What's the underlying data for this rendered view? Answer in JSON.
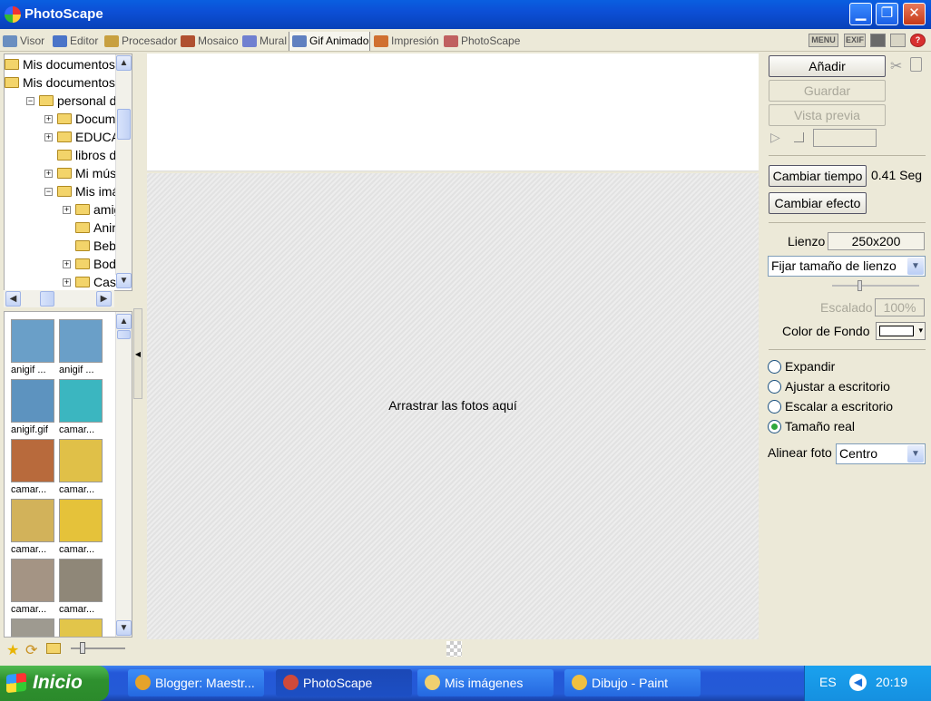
{
  "window": {
    "title": "PhotoScape",
    "minimize": "▁",
    "maximize": "❐",
    "close": "✕"
  },
  "tabs": [
    {
      "label": "Visor",
      "color": "#6b8fc0"
    },
    {
      "label": "Editor",
      "color": "#4a74c8"
    },
    {
      "label": "Procesador",
      "color": "#c8a040"
    },
    {
      "label": "Mosaico",
      "color": "#b05030"
    },
    {
      "label": "Mural",
      "color": "#7080d0"
    },
    {
      "label": "Gif Animado",
      "color": "#6080c0"
    },
    {
      "label": "Impresión",
      "color": "#d07030"
    },
    {
      "label": "PhotoScape",
      "color": "#c06060"
    }
  ],
  "active_tab": "Gif Animado",
  "toolbar_icons": {
    "menu": "MENU",
    "exif": "EXIF",
    "help": "?"
  },
  "tree": [
    {
      "label": "Mis documentos",
      "level": 0,
      "expander": ""
    },
    {
      "label": "Mis documentos",
      "level": 0,
      "expander": ""
    },
    {
      "label": "personal de n",
      "level": 1,
      "expander": "−"
    },
    {
      "label": "Documen",
      "level": 2,
      "expander": "+"
    },
    {
      "label": "EDUCACI",
      "level": 2,
      "expander": "+"
    },
    {
      "label": "libros digit",
      "level": 2,
      "expander": ""
    },
    {
      "label": "Mi música",
      "level": 2,
      "expander": "+"
    },
    {
      "label": "Mis imáge",
      "level": 2,
      "expander": "−"
    },
    {
      "label": "amigos",
      "level": 3,
      "expander": "+"
    },
    {
      "label": "Animal",
      "level": 3,
      "expander": ""
    },
    {
      "label": "Bebés",
      "level": 3,
      "expander": ""
    },
    {
      "label": "Bodas",
      "level": 3,
      "expander": "+"
    },
    {
      "label": "Casas",
      "level": 3,
      "expander": "+"
    }
  ],
  "thumbnails": [
    {
      "label": "anigif ...",
      "color": "#6a9fc8"
    },
    {
      "label": "anigif ...",
      "color": "#6a9fc8"
    },
    {
      "label": "anigif.gif",
      "color": "#5d93bf"
    },
    {
      "label": "camar...",
      "color": "#3bb6c0"
    },
    {
      "label": "camar...",
      "color": "#b86a3c"
    },
    {
      "label": "camar...",
      "color": "#e0c048"
    },
    {
      "label": "camar...",
      "color": "#d2b25a"
    },
    {
      "label": "camar...",
      "color": "#e5c23a"
    },
    {
      "label": "camar...",
      "color": "#a49484"
    },
    {
      "label": "camar...",
      "color": "#8f8778"
    },
    {
      "label": "",
      "color": "#9e9a90"
    },
    {
      "label": "",
      "color": "#e2c54a"
    }
  ],
  "stage": {
    "drop_hint": "Arrastrar las fotos aquí"
  },
  "panel": {
    "add": "Añadir",
    "save": "Guardar",
    "preview": "Vista previa",
    "change_time": "Cambiar tiempo",
    "time_value": "0.41 Seg",
    "change_effect": "Cambiar efecto",
    "canvas_label": "Lienzo",
    "canvas_value": "250x200",
    "canvas_mode": "Fijar tamaño de lienzo",
    "scale_label": "Escalado",
    "scale_value": "100%",
    "bg_color_label": "Color de Fondo",
    "bg_color": "#ffffff",
    "options": [
      {
        "label": "Expandir",
        "checked": false
      },
      {
        "label": "Ajustar a escritorio",
        "checked": false
      },
      {
        "label": "Escalar a escritorio",
        "checked": false
      },
      {
        "label": "Tamaño real",
        "checked": true
      }
    ],
    "align_label": "Alinear foto",
    "align_value": "Centro"
  },
  "taskbar": {
    "start": "Inicio",
    "tasks": [
      {
        "label": "Blogger: Maestr...",
        "active": false,
        "color": "#e5a32a"
      },
      {
        "label": "PhotoScape",
        "active": true,
        "color": "#d04a3a"
      },
      {
        "label": "Mis imágenes",
        "active": false,
        "color": "#f0d070"
      },
      {
        "label": "Dibujo - Paint",
        "active": false,
        "color": "#f0c040"
      }
    ],
    "lang": "ES",
    "clock": "20:19"
  }
}
